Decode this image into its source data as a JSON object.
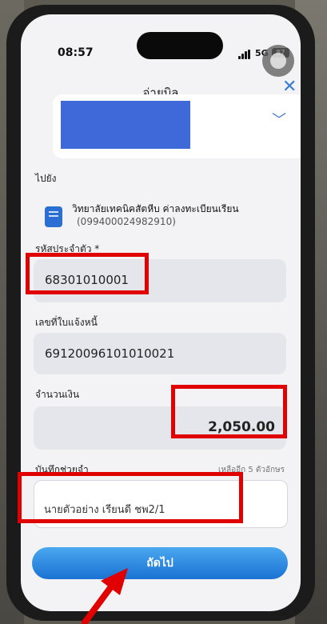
{
  "status": {
    "time": "08:57",
    "network": "5G",
    "battery": "87"
  },
  "header": {
    "title": "จ่ายบิล",
    "close_label": "✕"
  },
  "account": {
    "chevron": "﹀"
  },
  "destination": {
    "section_label": "ไปยัง",
    "name": "วิทยาลัยเทคนิคสัตหีบ ค่าลงทะเบียนเรียน",
    "account": "(099400024982910)"
  },
  "student_id": {
    "label": "รหัสประจำตัว *",
    "value": "68301010001"
  },
  "invoice": {
    "label": "เลขที่ใบแจ้งหนี้",
    "value": "69120096101010021"
  },
  "amount": {
    "label": "จำนวนเงิน",
    "value": "2,050.00"
  },
  "note": {
    "label": "บันทึกช่วยจำ",
    "remaining": "เหลืออีก 5 ตัวอักษร",
    "value": "นายตัวอย่าง เรียนดี ชพ2/1"
  },
  "next_button": {
    "label": "ถัดไป"
  },
  "colors": {
    "accent": "#1a72d3",
    "highlight": "#e10000",
    "redaction": "#3f68d8"
  }
}
